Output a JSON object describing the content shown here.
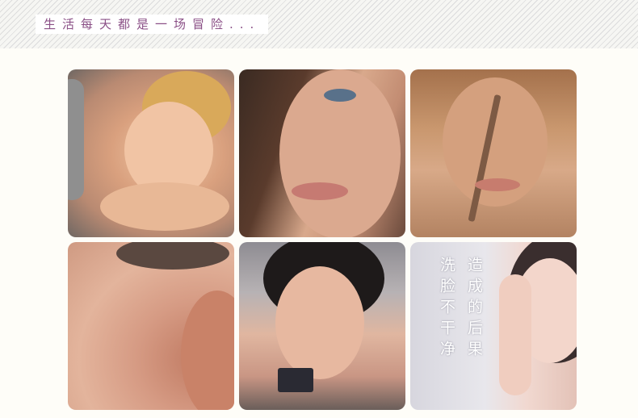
{
  "header": {
    "title": "生活每天都是一场冒险..."
  },
  "tiles": [
    {
      "id": "tile-1"
    },
    {
      "id": "tile-2"
    },
    {
      "id": "tile-3"
    },
    {
      "id": "tile-4"
    },
    {
      "id": "tile-5"
    },
    {
      "id": "tile-6",
      "text_col_1": "洗脸不干净",
      "text_col_2": "造成的后果"
    }
  ]
}
